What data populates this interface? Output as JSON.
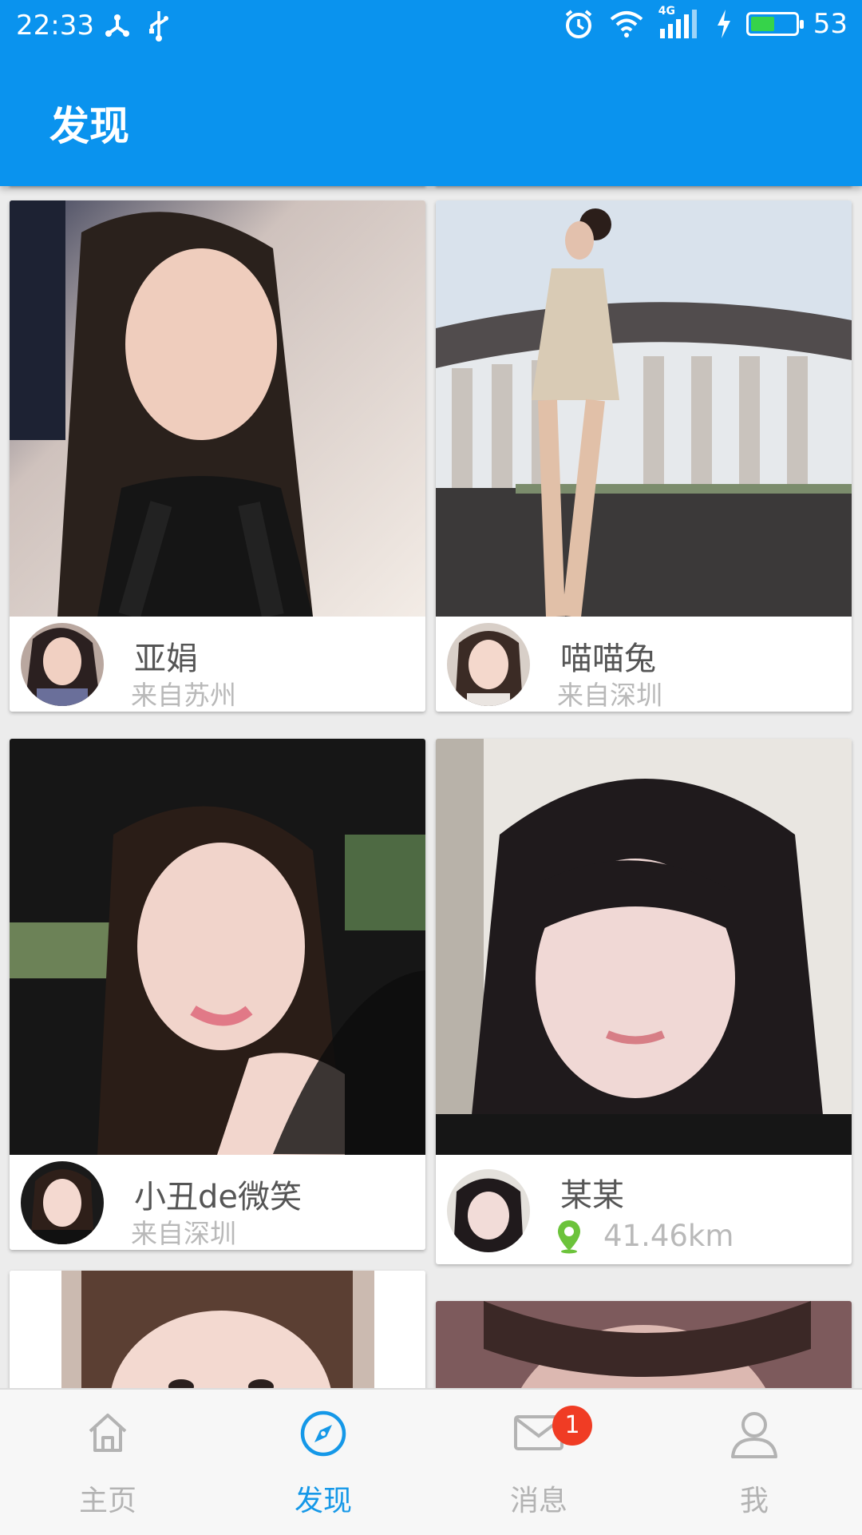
{
  "status_bar": {
    "time": "22:33",
    "network": "4G",
    "battery_percent": "53",
    "battery_level": 0.53,
    "left_icons": [
      "share-icon",
      "usb-icon"
    ],
    "right_icons": [
      "alarm-icon",
      "wifi-icon",
      "signal-icon",
      "charging-icon",
      "battery-icon"
    ]
  },
  "header": {
    "title": "发现"
  },
  "cards": [
    {
      "name": "亚娟",
      "location": "来自苏州",
      "photo_icon": "profile-photo",
      "avatar_icon": "avatar"
    },
    {
      "name": "喵喵兔",
      "location": "来自深圳",
      "photo_icon": "profile-photo",
      "avatar_icon": "avatar"
    },
    {
      "name": "小丑de微笑",
      "location": "来自深圳",
      "photo_icon": "profile-photo",
      "avatar_icon": "avatar"
    },
    {
      "name": "某某",
      "distance": "41.46km",
      "distance_icon": "location-pin-icon",
      "photo_icon": "profile-photo",
      "avatar_icon": "avatar"
    }
  ],
  "bottom_nav": {
    "items": [
      {
        "label": "主页",
        "icon": "home-icon",
        "active": false
      },
      {
        "label": "发现",
        "icon": "compass-icon",
        "active": true
      },
      {
        "label": "消息",
        "icon": "mail-icon",
        "active": false,
        "badge": "1"
      },
      {
        "label": "我",
        "icon": "user-icon",
        "active": false
      }
    ]
  },
  "colors": {
    "header_bg": "#0a93ee",
    "active_tab": "#1598e8",
    "inactive_tab": "#b3b3b3",
    "badge": "#f03c24",
    "pin": "#6cc33b"
  }
}
